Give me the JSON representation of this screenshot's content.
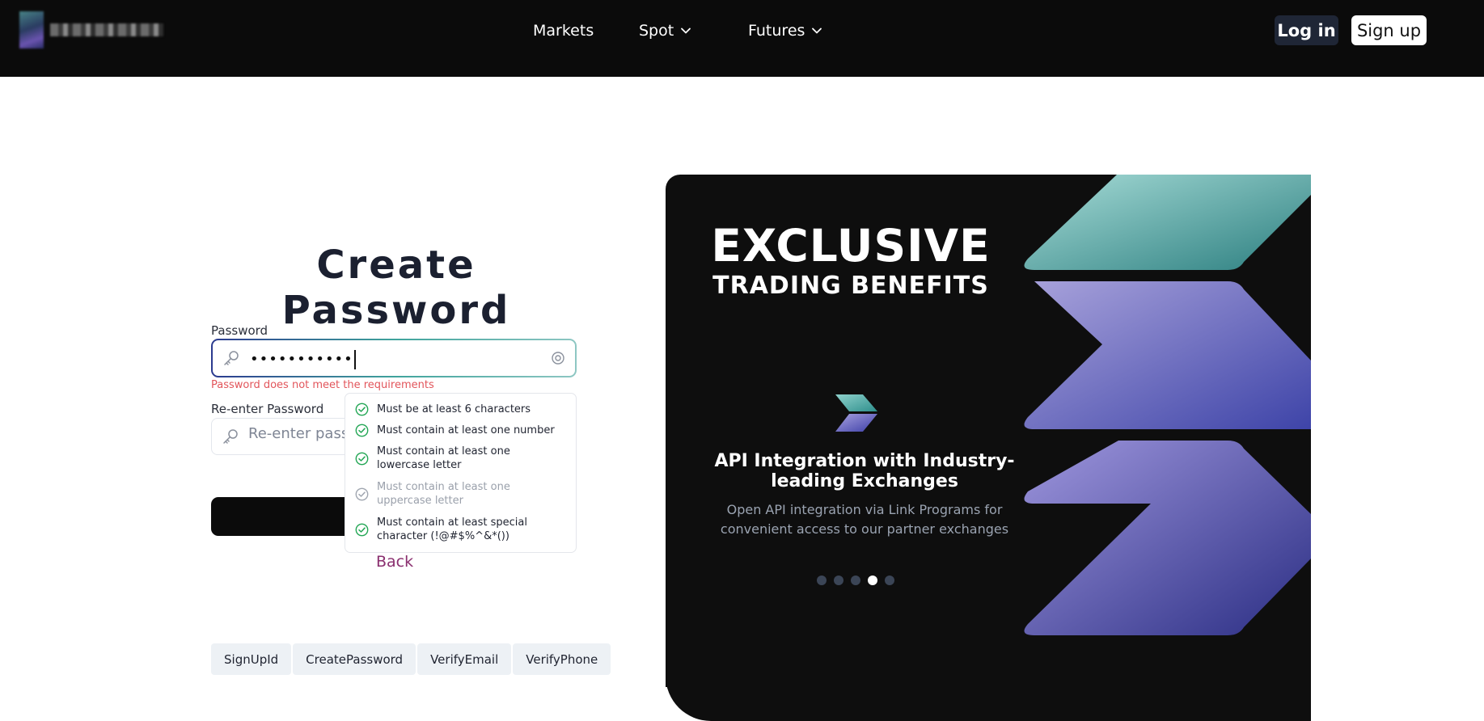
{
  "header": {
    "nav": [
      {
        "label": "Markets",
        "has_dropdown": false
      },
      {
        "label": "Spot",
        "has_dropdown": true
      },
      {
        "label": "Futures",
        "has_dropdown": true
      }
    ],
    "login_label": "Log in",
    "signup_label": "Sign up"
  },
  "form": {
    "title": "Create Password",
    "password_label": "Password",
    "password_value": "•••••••••••",
    "password_error": "Password does not meet the requirements",
    "reenter_label": "Re-enter Password",
    "reenter_placeholder": "Re-enter password",
    "back_label": "Back"
  },
  "requirements": [
    {
      "text": "Must be at least 6 characters",
      "met": true
    },
    {
      "text": "Must contain at least one number",
      "met": true
    },
    {
      "text": "Must contain at least one lowercase letter",
      "met": true
    },
    {
      "text": "Must contain at least one uppercase letter",
      "met": false
    },
    {
      "text": "Must contain at least special character (!@#$%^&*())",
      "met": true
    }
  ],
  "dev_tabs": [
    "SignUpId",
    "CreatePassword",
    "VerifyEmail",
    "VerifyPhone"
  ],
  "promo": {
    "heading": "EXCLUSIVE",
    "subheading": "TRADING BENEFITS",
    "feature_title": "API Integration with Industry-leading Exchanges",
    "feature_text": "Open API integration via Link Programs for convenient access to our partner exchanges",
    "carousel_count": 5,
    "carousel_active": 4
  },
  "colors": {
    "header_bg": "#0b0b0b",
    "error": "#e2555b",
    "back_link": "#8a2f6f",
    "check_green": "#22a654",
    "check_dim": "#a0a6b0"
  }
}
